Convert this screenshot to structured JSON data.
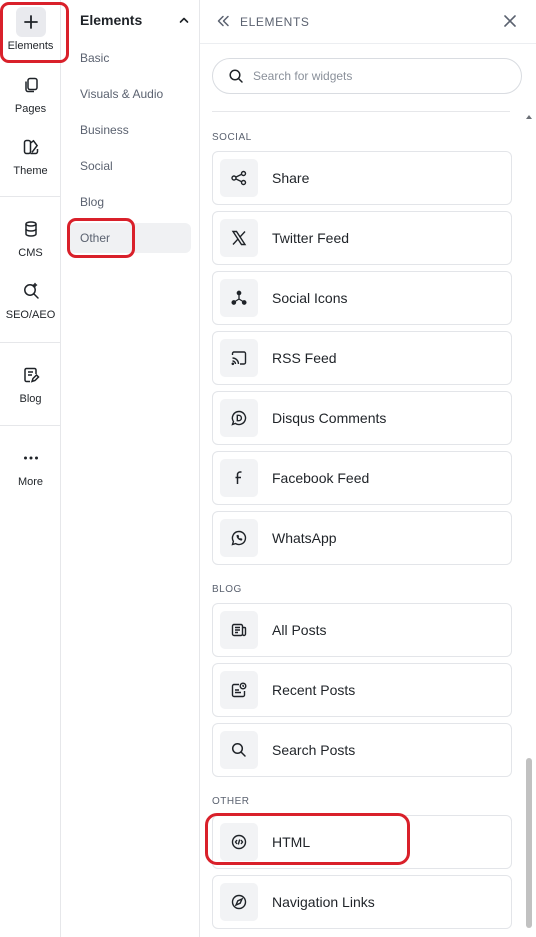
{
  "rail": {
    "items": [
      {
        "label": "Elements",
        "icon": "plus-icon"
      },
      {
        "label": "Pages",
        "icon": "pages-icon"
      },
      {
        "label": "Theme",
        "icon": "theme-icon"
      },
      {
        "label": "CMS",
        "icon": "database-icon"
      },
      {
        "label": "SEO/AEO",
        "icon": "seo-search-icon"
      },
      {
        "label": "Blog",
        "icon": "blog-icon"
      },
      {
        "label": "More",
        "icon": "more-dots-icon"
      }
    ]
  },
  "categories": {
    "title": "Elements",
    "items": [
      "Basic",
      "Visuals & Audio",
      "Business",
      "Social",
      "Blog",
      "Other"
    ],
    "active": "Other"
  },
  "panel": {
    "title": "ELEMENTS",
    "search_placeholder": "Search for widgets",
    "sections": [
      {
        "title": "SOCIAL",
        "items": [
          {
            "label": "Share",
            "icon": "share-icon"
          },
          {
            "label": "Twitter Feed",
            "icon": "x-logo-icon"
          },
          {
            "label": "Social Icons",
            "icon": "network-icon"
          },
          {
            "label": "RSS Feed",
            "icon": "cast-icon"
          },
          {
            "label": "Disqus Comments",
            "icon": "disqus-icon"
          },
          {
            "label": "Facebook Feed",
            "icon": "facebook-icon"
          },
          {
            "label": "WhatsApp",
            "icon": "whatsapp-icon"
          }
        ]
      },
      {
        "title": "BLOG",
        "items": [
          {
            "label": "All Posts",
            "icon": "posts-icon"
          },
          {
            "label": "Recent Posts",
            "icon": "recent-posts-icon"
          },
          {
            "label": "Search Posts",
            "icon": "search-icon"
          }
        ]
      },
      {
        "title": "OTHER",
        "items": [
          {
            "label": "HTML",
            "icon": "code-icon"
          },
          {
            "label": "Navigation Links",
            "icon": "compass-icon"
          }
        ]
      }
    ]
  },
  "colors": {
    "annotation": "#d9202a",
    "text": "#1f2328",
    "muted": "#5b6270",
    "border": "#e3e5e9"
  }
}
